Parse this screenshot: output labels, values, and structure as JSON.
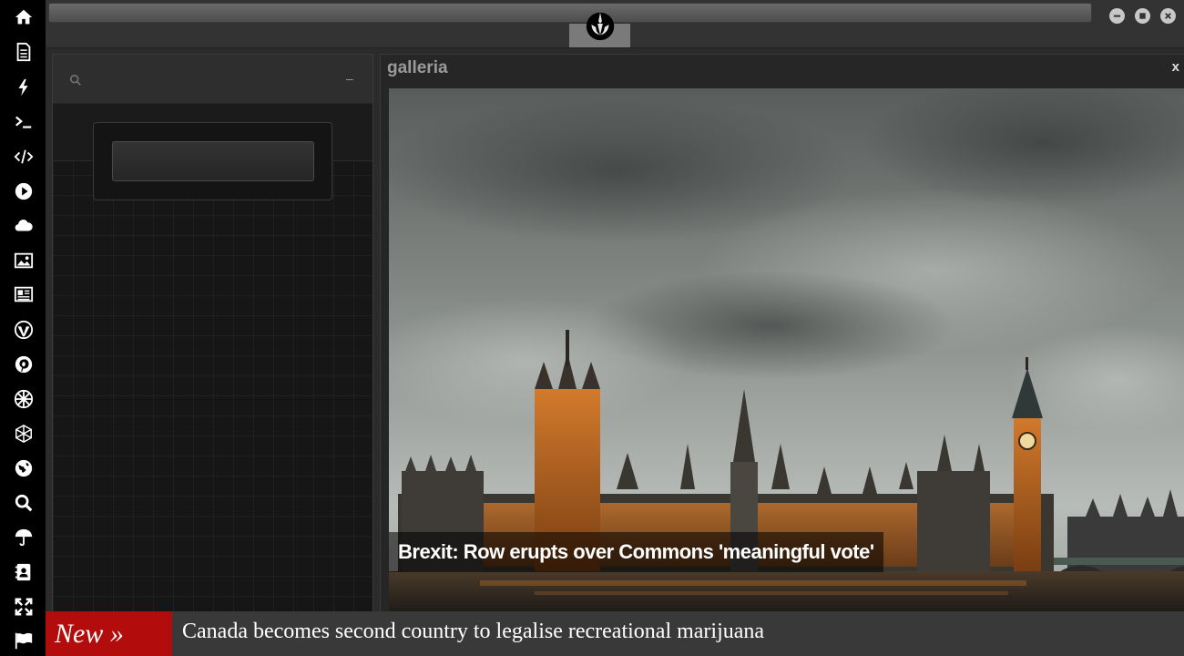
{
  "sidebar": {
    "icons": [
      "home-icon",
      "document-icon",
      "bolt-icon",
      "terminal-icon",
      "code-icon",
      "play-icon",
      "cloud-icon",
      "image-icon",
      "newspaper-icon",
      "wordpress-icon",
      "pinterest-icon",
      "empire-icon",
      "globe-wire-icon",
      "globe-icon",
      "search-icon",
      "umbrella-icon",
      "contact-icon",
      "fullscreen-icon",
      "flag-icon"
    ]
  },
  "topbar": {
    "emblem": "rebel-alliance-icon",
    "window_buttons": [
      "minimize-icon",
      "maximize-icon",
      "close-icon"
    ]
  },
  "left_panel": {
    "search_icon": "search-icon",
    "minimize_label": "–"
  },
  "galleria": {
    "title": "galleria",
    "close_label": "x",
    "caption": "Brexit: Row erupts over Commons 'meaningful vote'"
  },
  "ticker": {
    "new_label": "New »",
    "headline": "Canada becomes second country to legalise recreational marijuana"
  },
  "colors": {
    "sidebar_bg": "#000000",
    "ticker_accent": "#b30c0c",
    "panel_bg": "#161616"
  }
}
